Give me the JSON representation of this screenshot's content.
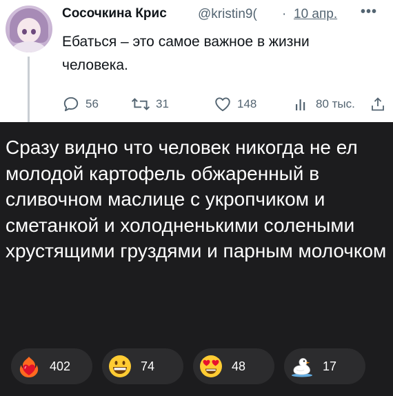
{
  "tweet": {
    "author_name": "Сосочкина Крис",
    "handle": "@kristin9(",
    "separator": "·",
    "date": "10 апр.",
    "more": "•••",
    "text": "Ебаться – это самое важное в жизни человека.",
    "stats": {
      "replies": "56",
      "retweets": "31",
      "likes": "148",
      "views": "80 тыс."
    },
    "icons": {
      "reply": "reply-icon",
      "retweet": "retweet-icon",
      "like": "heart-outline-icon",
      "views": "views-bar-icon",
      "share": "share-icon"
    }
  },
  "comment": {
    "text": "Сразу видно что человек никогда не ел молодой картофель обжаренный в сливочном маслице с укропчиком и сметанкой и холодненькими солеными хрустящими груздями и парным молочком",
    "reactions": [
      {
        "emoji": "burning-heart-emoji",
        "count": "402"
      },
      {
        "emoji": "grinning-face-emoji",
        "count": "74"
      },
      {
        "emoji": "heart-eyes-emoji",
        "count": "48"
      },
      {
        "emoji": "duck-emoji",
        "count": "17"
      }
    ]
  },
  "colors": {
    "tweet_bg": "#ffffff",
    "tweet_text": "#0f1419",
    "muted": "#536471",
    "comment_bg": "#1c1c1e",
    "chip_bg": "#2c2c2e",
    "comment_text": "#ffffff"
  }
}
